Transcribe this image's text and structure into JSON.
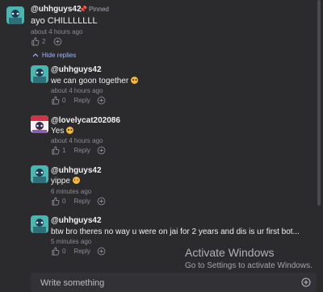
{
  "pinned_comment": {
    "username": "@uhhguys42",
    "pinned_label": "Pinned",
    "text": "ayo CHILLLLLLL",
    "time": "about 4 hours ago",
    "likes": "2"
  },
  "hide_replies_label": "Hide replies",
  "replies": [
    {
      "username": "@uhhguys42",
      "text": "we can goon together",
      "time": "about 4 hours ago",
      "likes": "0",
      "reply_label": "Reply"
    },
    {
      "username": "@lovelycat202086",
      "text": "Yes",
      "time": "about 4 hours ago",
      "likes": "1",
      "reply_label": "Reply"
    },
    {
      "username": "@uhhguys42",
      "text": "yippe",
      "time": "6 minutes ago",
      "likes": "0",
      "reply_label": "Reply"
    },
    {
      "username": "@uhhguys42",
      "text": "btw bro theres no way u were on jai for 2 years and dis is ur first bot...",
      "time": "5 minutes ago",
      "likes": "0",
      "reply_label": "Reply"
    }
  ],
  "composer": {
    "placeholder": "Write something"
  },
  "watermark": {
    "title": "Activate Windows",
    "subtitle": "Go to Settings to activate Windows."
  },
  "icons": {
    "like": "thumbs-up-icon",
    "add": "add-circle-icon",
    "pin": "pin-icon",
    "collapse": "chevron-up-icon"
  }
}
